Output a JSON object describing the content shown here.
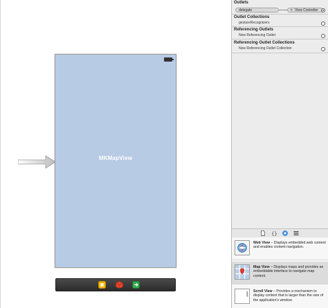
{
  "canvas": {
    "map_view_label": "MKMapView",
    "view_background": "#b7cbe5",
    "dock_icons": [
      "first-responder-icon",
      "cube-icon",
      "exit-icon"
    ]
  },
  "inspector": {
    "outlets": {
      "header": "Outlets",
      "outlet_name": "delegate",
      "target_name": "View Controller"
    },
    "outlet_collections": {
      "header": "Outlet Collections",
      "rows": [
        "gestureRecognizers"
      ]
    },
    "referencing_outlets": {
      "header": "Referencing Outlets",
      "rows": [
        "New Referencing Outlet"
      ]
    },
    "referencing_outlet_collections": {
      "header": "Referencing Outlet Collections",
      "rows": [
        "New Referencing Outlet Collection"
      ]
    }
  },
  "library": {
    "tabs": [
      "file-template-icon",
      "code-snippet-icon",
      "object-library-icon",
      "media-library-icon"
    ],
    "items": [
      {
        "title": "Web View",
        "description": " – Displays embedded web content and enables content navigation.",
        "icon": "web-view-icon"
      },
      {
        "title": "Map View",
        "description": " – Displays maps and provides an embeddable interface to navigate map content.",
        "icon": "map-view-icon"
      },
      {
        "title": "Scroll View",
        "description": " – Provides a mechanism to display content that is larger than the size of the application's window.",
        "icon": "scroll-view-icon"
      }
    ]
  }
}
